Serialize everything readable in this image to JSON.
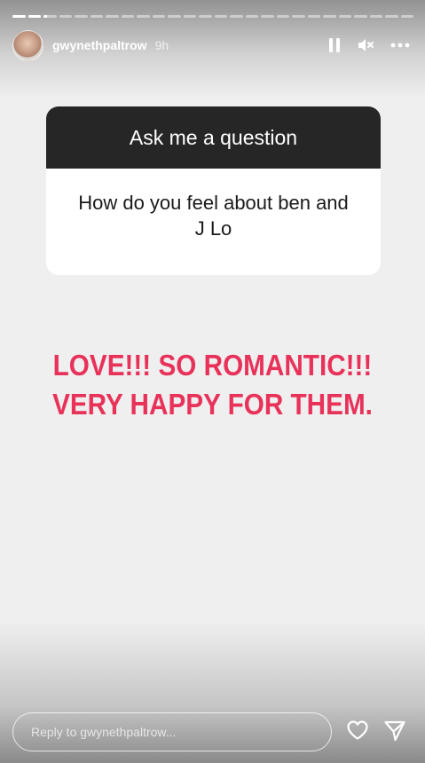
{
  "story": {
    "progress": [
      1,
      1,
      0.3,
      0,
      0,
      0,
      0,
      0,
      0,
      0,
      0,
      0,
      0,
      0,
      0,
      0,
      0,
      0,
      0,
      0,
      0,
      0,
      0,
      0,
      0,
      0
    ]
  },
  "header": {
    "username": "gwynethpaltrow",
    "time": "9h",
    "icons": {
      "avatar": "profile-avatar",
      "pause": "pause-icon",
      "mute": "speaker-muted-icon",
      "more": "more-horizontal-icon"
    }
  },
  "question_sticker": {
    "title": "Ask me a question",
    "question": "How do you feel about ben and J Lo"
  },
  "answer": {
    "line1": "LOVE!!! SO ROMANTIC!!!",
    "line2": "VERY HAPPY FOR THEM."
  },
  "footer": {
    "reply_placeholder": "Reply to gwynethpaltrow...",
    "icons": {
      "like": "heart-icon",
      "send": "send-icon"
    }
  },
  "colors": {
    "answer_text": "#e8325a",
    "card_header": "#262626",
    "background": "#efefef"
  }
}
